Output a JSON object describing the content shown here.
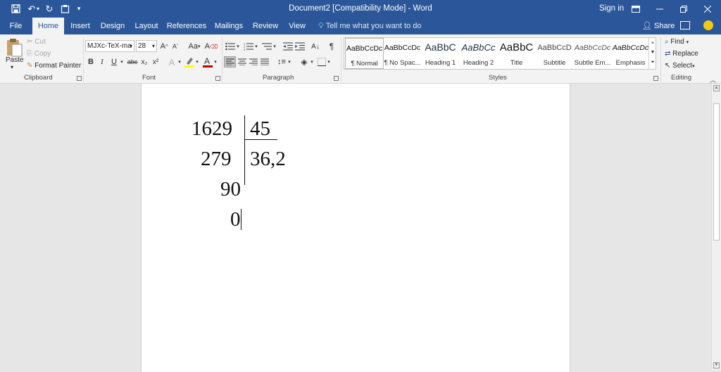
{
  "window": {
    "title": "Document2 [Compatibility Mode] - Word",
    "sign_in": "Sign in"
  },
  "tabs": [
    "File",
    "Home",
    "Insert",
    "Design",
    "Layout",
    "References",
    "Mailings",
    "Review",
    "View"
  ],
  "active_tab": "Home",
  "tell_me": "Tell me what you want to do",
  "share": "Share",
  "clipboard": {
    "paste": "Paste",
    "cut": "Cut",
    "copy": "Copy",
    "format_painter": "Format Painter",
    "group_label": "Clipboard"
  },
  "font": {
    "name": "MJXc-TeX-ma",
    "size": "28",
    "group_label": "Font",
    "bold": "B",
    "italic": "I",
    "underline": "U",
    "strike": "abc",
    "subscript": "x₂",
    "superscript": "x²",
    "change_case": "Aa",
    "grow": "A",
    "shrink": "A"
  },
  "paragraph": {
    "group_label": "Paragraph"
  },
  "styles": {
    "group_label": "Styles",
    "items": [
      {
        "preview": "AaBbCcDc",
        "name": "¶ Normal"
      },
      {
        "preview": "AaBbCcDc",
        "name": "¶ No Spac..."
      },
      {
        "preview": "AaBbC",
        "name": "Heading 1"
      },
      {
        "preview": "AaBbCc",
        "name": "Heading 2"
      },
      {
        "preview": "AaBbC",
        "name": "Title"
      },
      {
        "preview": "AaBbCcD",
        "name": "Subtitle"
      },
      {
        "preview": "AaBbCcDc",
        "name": "Subtle Em..."
      },
      {
        "preview": "AaBbCcDc",
        "name": "Emphasis"
      }
    ]
  },
  "editing": {
    "find": "Find",
    "replace": "Replace",
    "select": "Select",
    "group_label": "Editing"
  },
  "document": {
    "dividend": "1629",
    "divisor": "45",
    "remainder1": "279",
    "quotient": "36,2",
    "remainder2": "90",
    "remainder3": "0"
  },
  "colors": {
    "brand": "#2b579a",
    "ribbon": "#f3f3f3",
    "canvas": "#e6e6e6",
    "highlight": "#ffff00",
    "font_color": "#c00000"
  }
}
